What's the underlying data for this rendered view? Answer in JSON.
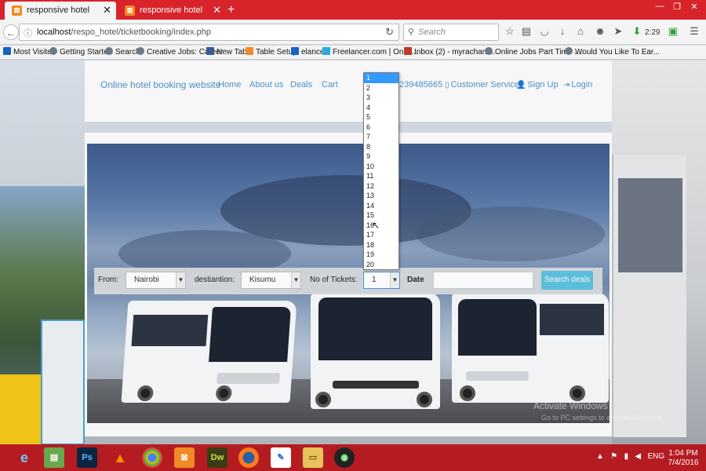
{
  "browser": {
    "tabs": [
      {
        "label": "responsive hotel",
        "active": true
      },
      {
        "label": "responsive hotel",
        "active": false
      }
    ],
    "url_host": "localhost",
    "url_path": "/respo_hotel/ticketbooking/index.php",
    "search_placeholder": "Search",
    "download_time": "2:29"
  },
  "bookmarks": [
    "Most Visited",
    "Getting Started",
    "Search",
    "Creative Jobs: Career",
    "New Tab",
    "Table Setup",
    "elance",
    "Freelancer.com | Onlin...",
    "Inbox (2) - myrachant...",
    "Online Jobs Part Time ...",
    "Would You Like To Ear..."
  ],
  "site": {
    "brand": "Online hotel booking website",
    "nav": {
      "home": "Home",
      "about": "About us",
      "deals": "Deals",
      "cart": "Cart"
    },
    "phone": "239485665",
    "customer_service": "Customer Service",
    "sign_up": "Sign Up",
    "login": "Login"
  },
  "search_form": {
    "from_label": "From:",
    "from_value": "Nairobi",
    "dest_label": "destiantion:",
    "dest_value": "Kisumu",
    "tickets_label": "No of Tickets:",
    "tickets_value": "1",
    "date_label": "Date",
    "date_value": "",
    "search_button": "Search deals"
  },
  "ticket_options": [
    "1",
    "2",
    "3",
    "4",
    "5",
    "6",
    "7",
    "8",
    "9",
    "10",
    "11",
    "12",
    "13",
    "14",
    "15",
    "16",
    "17",
    "18",
    "19",
    "20"
  ],
  "watermark": {
    "line1": "Activate Windows",
    "line2": "Go to PC settings to activate Windows."
  },
  "taskbar": {
    "apps": [
      "IE",
      "Notepad",
      "Ps",
      "VLC",
      "Chrome",
      "XAMPP",
      "Dw",
      "Firefox",
      "Paint",
      "Folder",
      "Camera"
    ],
    "lang": "ENG",
    "time": "1:04 PM",
    "date": "7/4/2016"
  },
  "colors": {
    "tabbar": "#d8232a",
    "link": "#4a90c2",
    "search_button": "#5bc0de",
    "taskbar": "#b41c22",
    "selected_option": "#3399ff"
  }
}
